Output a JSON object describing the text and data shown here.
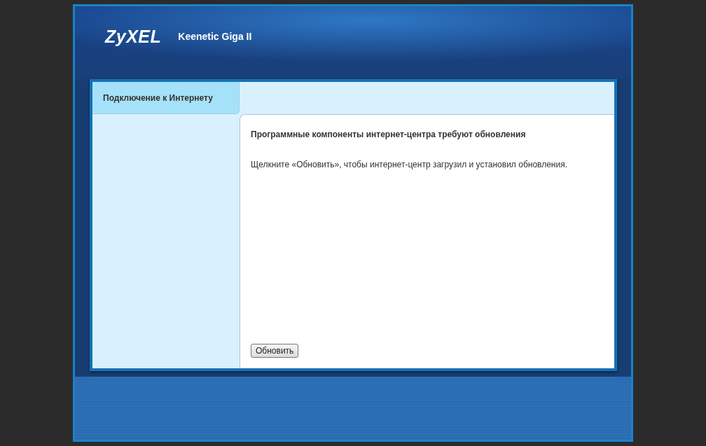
{
  "header": {
    "logo": "ZyXEL",
    "model": "Keenetic Giga II"
  },
  "sidebar": {
    "items": [
      {
        "label": "Подключение к Интернету",
        "selected": true
      }
    ]
  },
  "content": {
    "heading": "Программные компоненты интернет-центра требуют обновления",
    "message": "Щелкните «Обновить», чтобы интернет-центр загрузил и установил обновления.",
    "button": "Обновить"
  }
}
